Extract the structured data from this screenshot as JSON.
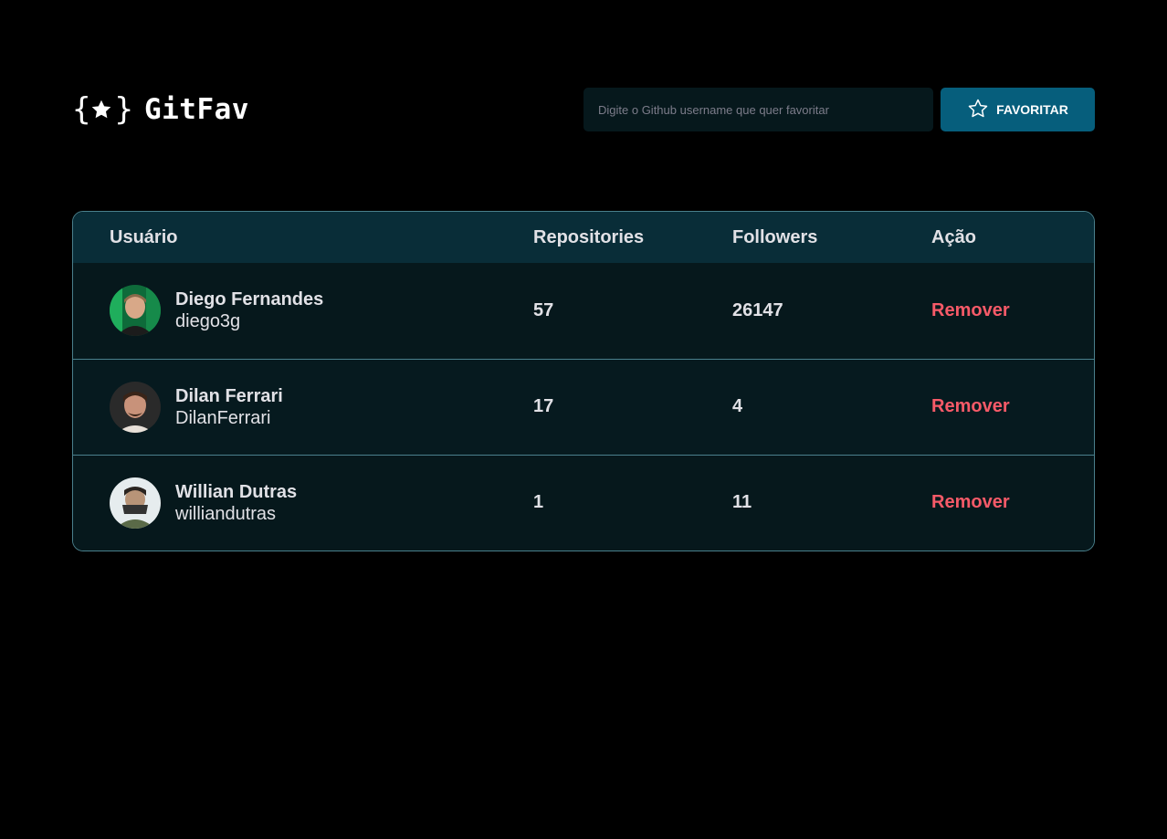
{
  "app": {
    "title": "GitFav"
  },
  "search": {
    "placeholder": "Digite o Github username que quer favoritar",
    "button_label": "Favoritar"
  },
  "table": {
    "headers": {
      "user": "Usuário",
      "repositories": "Repositories",
      "followers": "Followers",
      "action": "Ação"
    },
    "rows": [
      {
        "name": "Diego Fernandes",
        "login": "diego3g",
        "repositories": "57",
        "followers": "26147",
        "action": "Remover"
      },
      {
        "name": "Dilan Ferrari",
        "login": "DilanFerrari",
        "repositories": "17",
        "followers": "4",
        "action": "Remover"
      },
      {
        "name": "Willian Dutras",
        "login": "williandutras",
        "repositories": "1",
        "followers": "11",
        "action": "Remover"
      }
    ]
  },
  "colors": {
    "background": "#000000",
    "accent": "#065E7C",
    "header_row": "#092D38",
    "danger": "#F75A68",
    "border": "#4A808C"
  },
  "icons": {
    "logo": "star-braces-icon",
    "favorite": "star-outline-icon"
  }
}
